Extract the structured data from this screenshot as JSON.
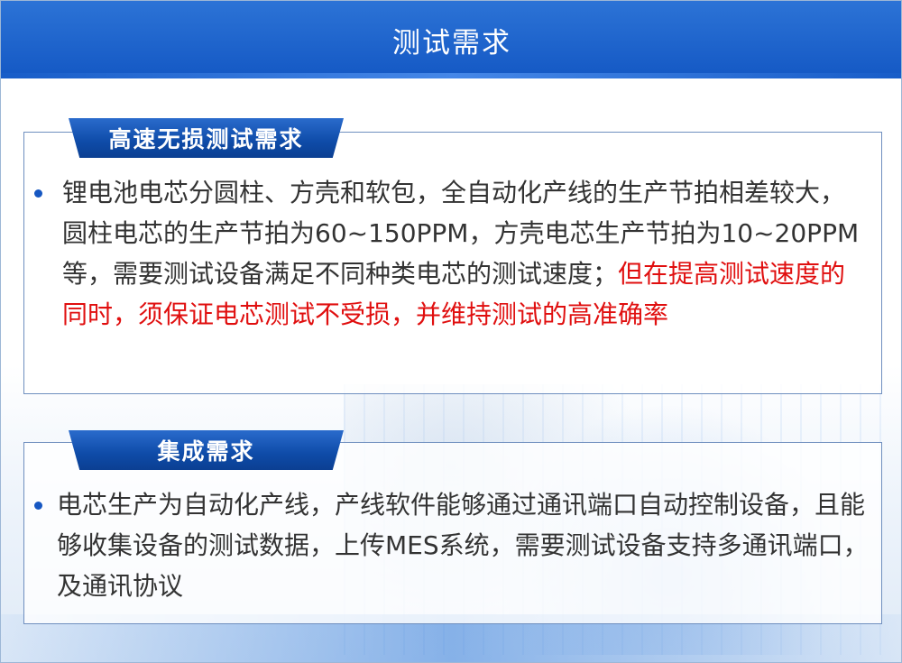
{
  "header": {
    "title": "测试需求"
  },
  "sections": [
    {
      "tag": "高速无损测试需求",
      "text_normal": "锂电池电芯分圆柱、方壳和软包，全自动化产线的生产节拍相差较大，圆柱电芯的生产节拍为60~150PPM，方壳电芯生产节拍为10~20PPM等，需要测试设备满足不同种类电芯的测试速度；",
      "text_highlight": "但在提高测试速度的同时，须保证电芯测试不受损，并维持测试的高准确率"
    },
    {
      "tag": "集成需求",
      "text_normal": "电芯生产为自动化产线，产线软件能够通过通讯端口自动控制设备，且能够收集设备的测试数据，上传MES系统，需要测试设备支持多通讯端口，及通讯协议"
    }
  ],
  "colors": {
    "header_blue": "#1458c4",
    "highlight_red": "#e00f0f",
    "text": "#333333"
  }
}
